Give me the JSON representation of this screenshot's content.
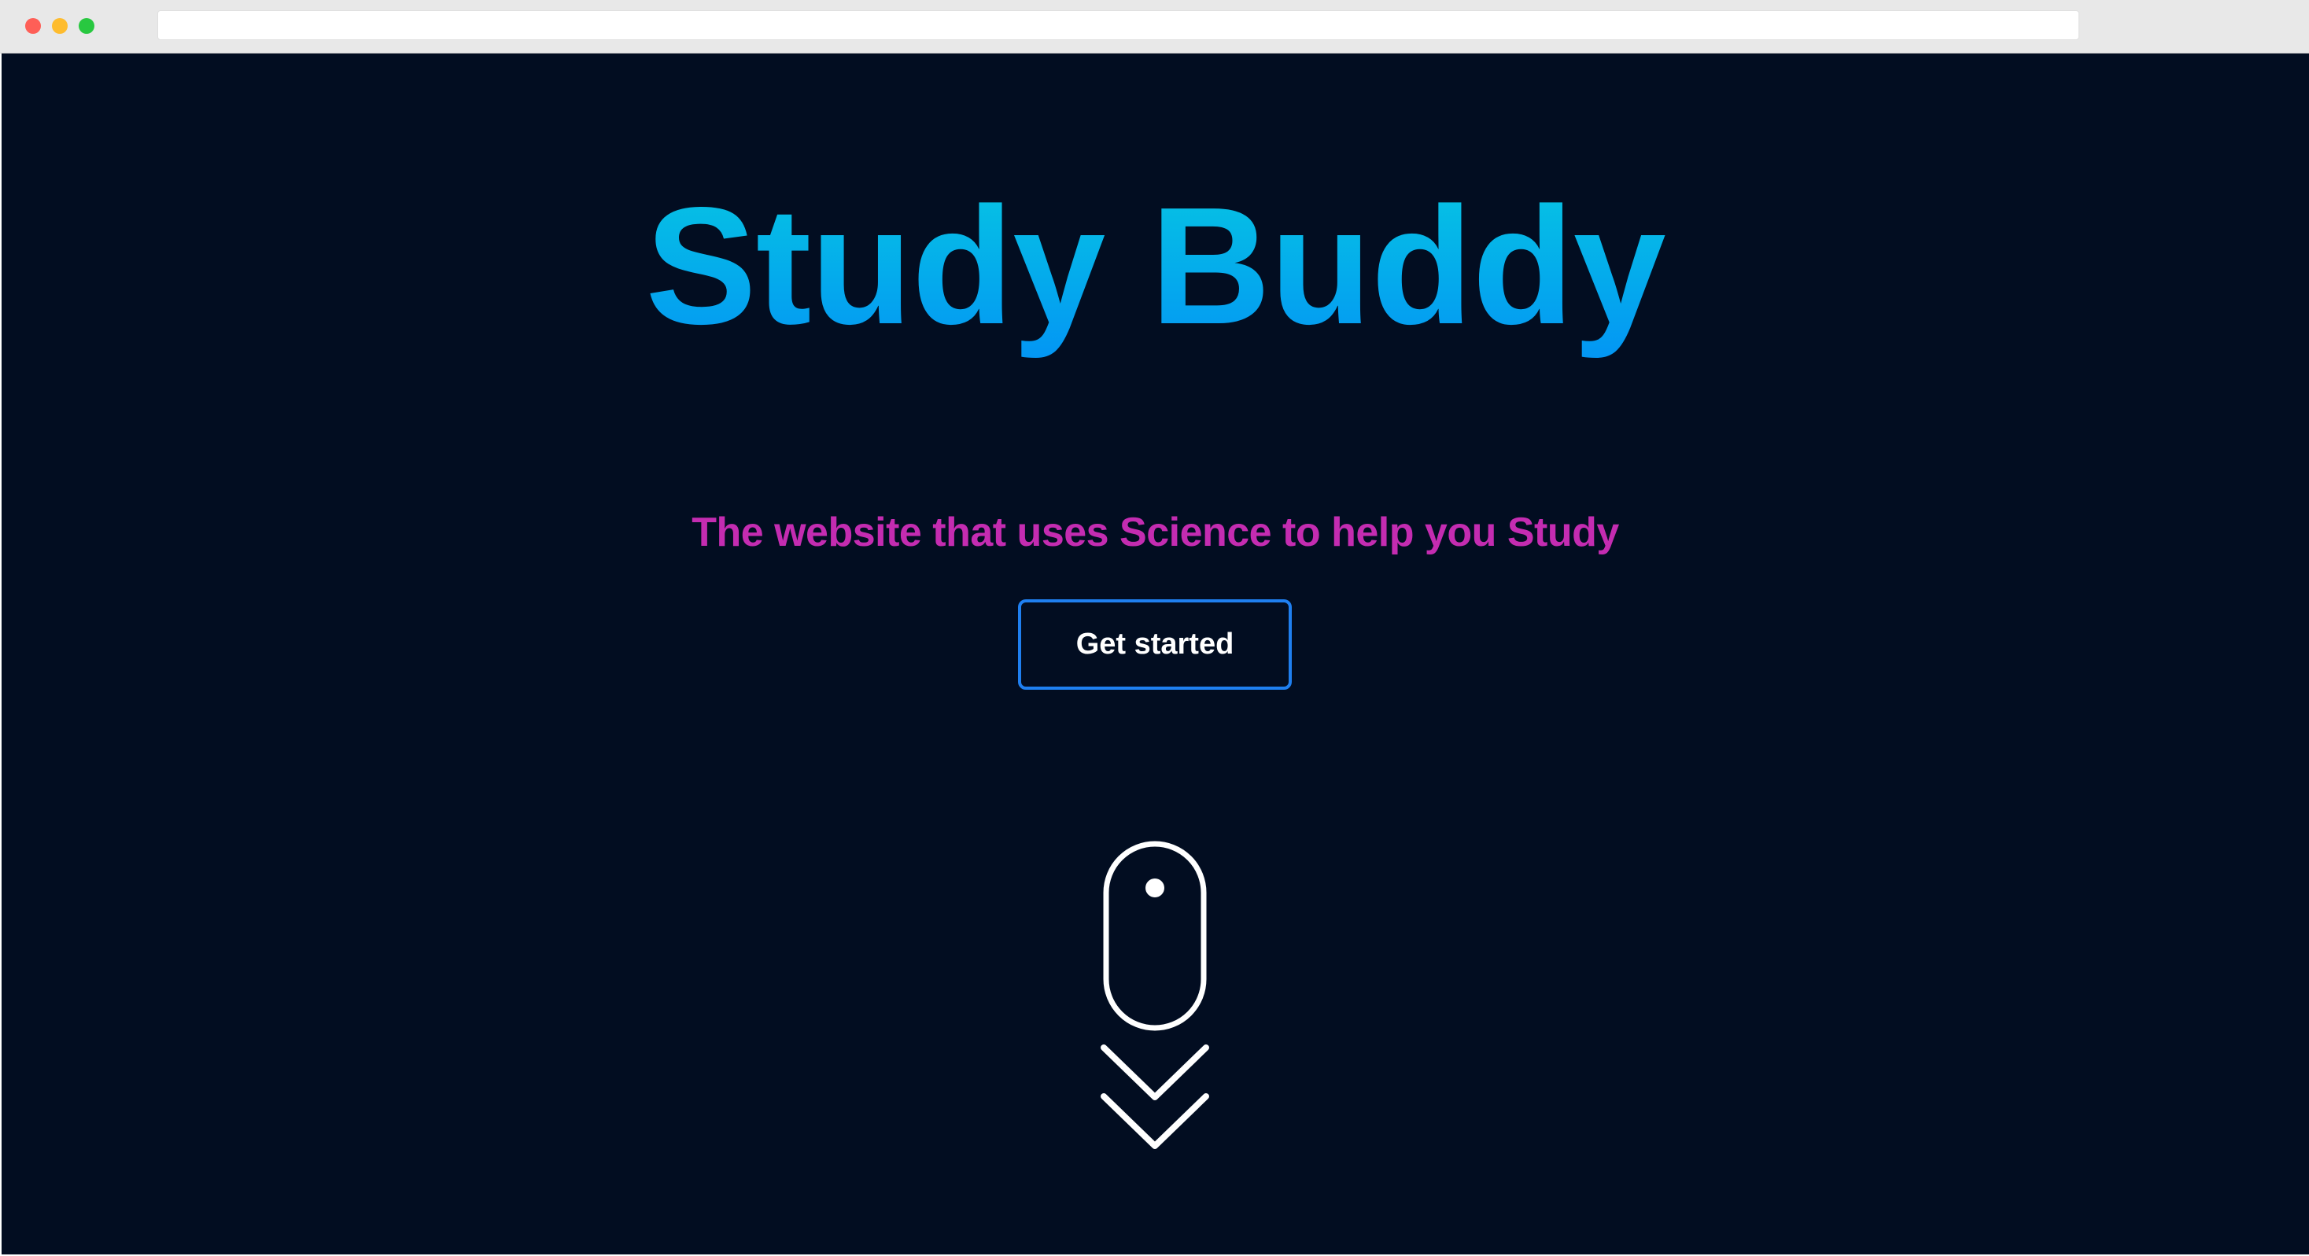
{
  "browser": {
    "address_value": "",
    "window_controls": [
      "close-icon",
      "minimize-icon",
      "maximize-icon"
    ]
  },
  "hero": {
    "title": "Study Buddy",
    "subtitle": "The website that uses Science to help you Study",
    "cta_label": "Get started"
  },
  "scroll_hint": {
    "icons": [
      "mouse-icon",
      "chevron-down-icon",
      "chevron-down-icon"
    ]
  },
  "colors": {
    "background": "#020d21",
    "title_gradient_top": "#06c6e2",
    "title_gradient_bottom": "#0396f4",
    "subtitle": "#c42cb1",
    "button_border": "#1f7ff0",
    "icon_stroke": "#ffffff"
  }
}
